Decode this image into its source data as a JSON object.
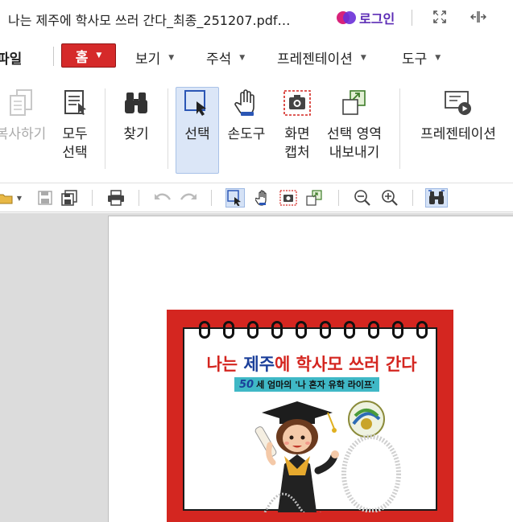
{
  "titlebar": {
    "title": "나는 제주에 학사모 쓰러 간다_최종_251207.pdf…",
    "login_label": "로그인",
    "icons": [
      "login-logo-icon",
      "fullscreen-icon",
      "fit-width-icon"
    ]
  },
  "menubar": {
    "file_partial": "파일",
    "home_label": "홈",
    "view_label": "보기",
    "annotation_label": "주석",
    "presentation_label": "프레젠테이션",
    "tools_label": "도구"
  },
  "ribbon": {
    "copy_label": "복사하기",
    "select_all_line1": "모두",
    "select_all_line2": "선택",
    "find_label": "찾기",
    "select_label": "선택",
    "hand_label": "손도구",
    "capture_line1": "화면",
    "capture_line2": "캡처",
    "export_line1": "선택 영역",
    "export_line2": "내보내기",
    "presentation_label": "프레젠테이션"
  },
  "cover": {
    "title_prefix": "나는 ",
    "title_highlight": "제주",
    "title_suffix": "에 학사모 쓰러 간다",
    "sub_number": "50",
    "sub_text": "세 엄마의 '나 혼자 유학 라이프'",
    "accent_red": "#d42620",
    "accent_blue": "#1b3f9a",
    "accent_teal": "#3fb8c6"
  },
  "colors": {
    "home_button": "#d52a2a",
    "selected_tool_bg": "#dbe6f7",
    "workspace_bg": "#dcdcdc"
  }
}
